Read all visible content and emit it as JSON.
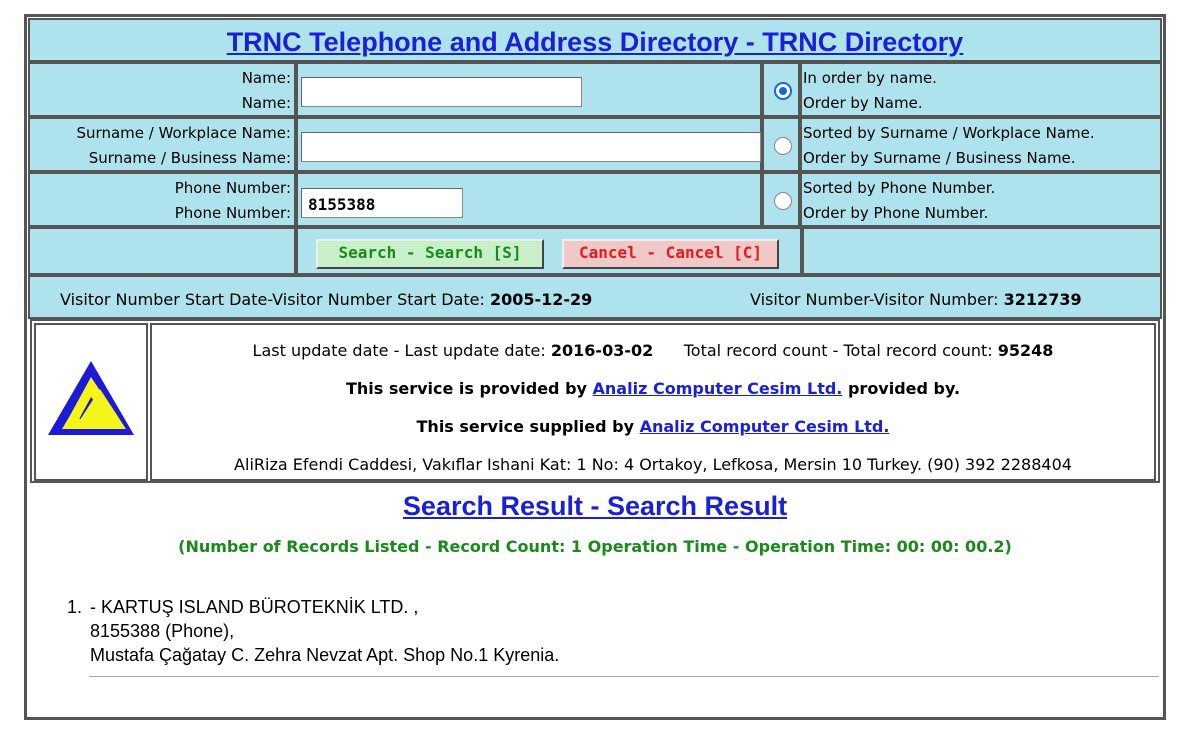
{
  "header": {
    "title": "TRNC Telephone and Address Directory - TRNC Directory"
  },
  "form": {
    "name_label_1": "Name:",
    "name_label_2": "Name:",
    "name_value": "",
    "surname_label_1": "Surname / Workplace Name:",
    "surname_label_2": "Surname / Business Name:",
    "surname_value": "",
    "phone_label_1": "Phone Number:",
    "phone_label_2": "Phone Number:",
    "phone_value": "8155388",
    "order_name_1": "In order by name.",
    "order_name_2": "Order by Name.",
    "order_surname_1": "Sorted by Surname / Workplace Name.",
    "order_surname_2": "Order by Surname / Business Name.",
    "order_phone_1": "Sorted by Phone Number.",
    "order_phone_2": "Order by Phone Number.",
    "selected_order": "name",
    "search_button": "Search - Search [S]",
    "cancel_button": "Cancel - Cancel [C]"
  },
  "visitor": {
    "start_label": "Visitor Number Start Date-Visitor Number Start Date:",
    "start_value": "2005-12-29",
    "count_label": "Visitor Number-Visitor Number:",
    "count_value": "3212739"
  },
  "info": {
    "update_label": "Last update date - Last update date:",
    "update_value": "2016-03-02",
    "total_label": "Total record count - Total record count:",
    "total_value": "95248",
    "provided_prefix": "This service is provided by",
    "provided_link": "Analiz Computer Cesim Ltd.",
    "provided_suffix": "provided by.",
    "supplied_prefix": "This service supplied by",
    "supplied_link": "Analiz Computer Cesim Ltd.",
    "address": "AliRiza Efendi Caddesi, Vakıflar Ishani Kat: 1 No: 4 Ortakoy, Lefkosa, Mersin 10 Turkey. (90) 392 2288404",
    "colors": {
      "logo_blue": "#1a1ad8",
      "logo_yellow": "#f5f51a"
    }
  },
  "results": {
    "title": "Search Result - Search Result",
    "count_line": "(Number of Records Listed - Record Count: 1 Operation Time - Operation Time: 00: 00: 00.2)",
    "items": [
      {
        "number": "1.",
        "line1": "- KARTUŞ ISLAND BÜROTEKNİK LTD. ,",
        "line2": "8155388 (Phone),",
        "line3": "Mustafa Çağatay C. Zehra Nevzat Apt. Shop No.1 Kyrenia."
      }
    ]
  },
  "colors": {
    "panel_bg": "#aee3ee",
    "link": "#1a20d8",
    "search_text": "#1a8a1a",
    "cancel_text": "#e81a1a"
  }
}
